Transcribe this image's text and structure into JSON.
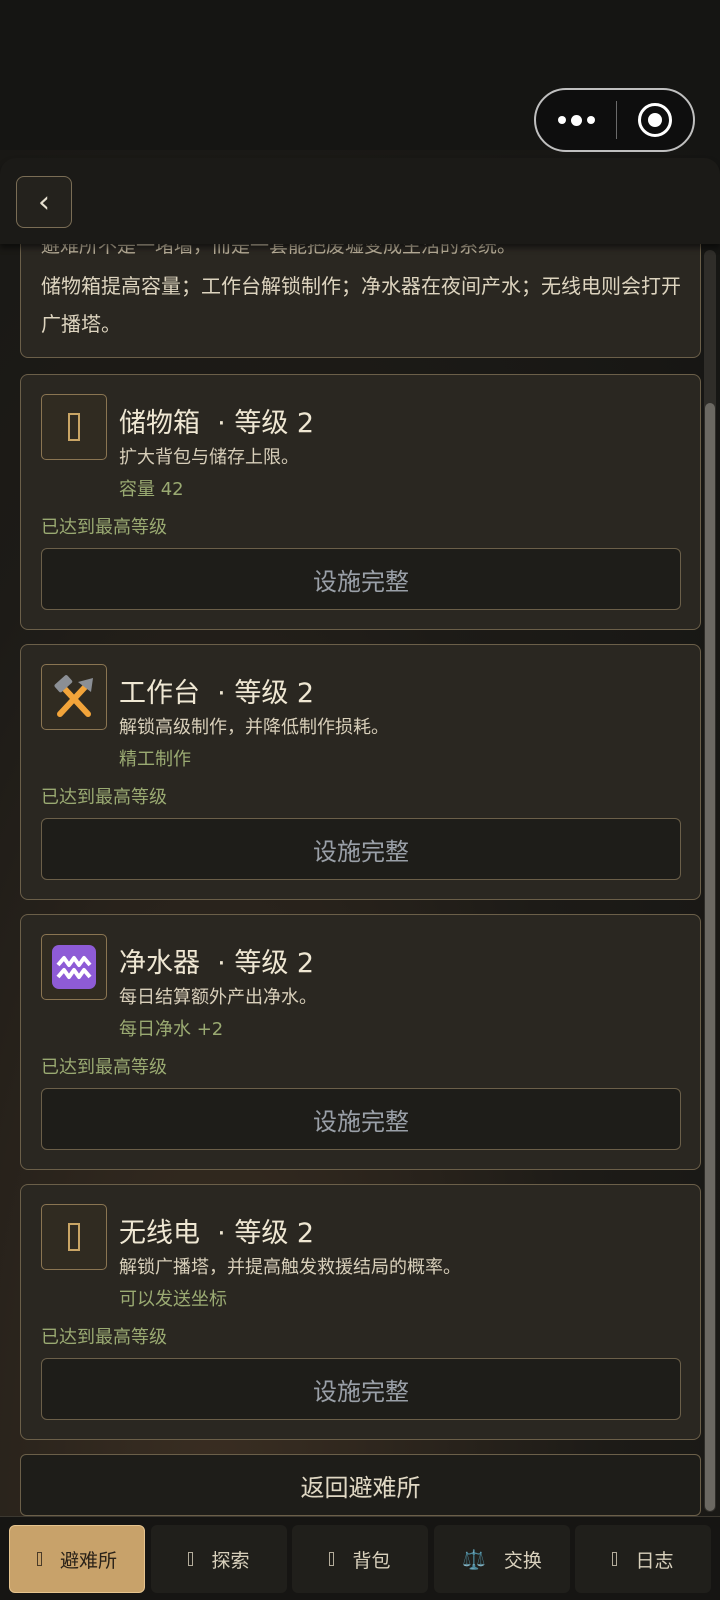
{
  "capsule": {
    "menu_icon": "more-dots-icon",
    "close_icon": "target-icon"
  },
  "header": {
    "back_icon": "chevron-left-icon",
    "back_glyph": "‹"
  },
  "intro": {
    "clipped_line": "避难所不是一堵墙，而是一套能把废墟变成生活的系统。",
    "text": "储物箱提高容量；工作台解锁制作；净水器在夜间产水；无线电则会打开广播塔。"
  },
  "facilities": [
    {
      "name": "储物箱",
      "level_label": "· 等级 2",
      "desc": "扩大背包与储存上限。",
      "effect": "容量 42",
      "status": "已达到最高等级",
      "action": "设施完整",
      "icon": "box-icon"
    },
    {
      "name": "工作台",
      "level_label": "· 等级 2",
      "desc": "解锁高级制作，并降低制作损耗。",
      "effect": "精工制作",
      "status": "已达到最高等级",
      "action": "设施完整",
      "icon": "hammer-pick-icon"
    },
    {
      "name": "净水器",
      "level_label": "· 等级 2",
      "desc": "每日结算额外产出净水。",
      "effect": "每日净水 +2",
      "status": "已达到最高等级",
      "action": "设施完整",
      "icon": "aquarius-icon"
    },
    {
      "name": "无线电",
      "level_label": "· 等级 2",
      "desc": "解锁广播塔，并提高触发救援结局的概率。",
      "effect": "可以发送坐标",
      "status": "已达到最高等级",
      "action": "设施完整",
      "icon": "box-icon"
    }
  ],
  "return_label": "返回避难所",
  "nav": [
    {
      "label": "避难所",
      "icon": "box-icon",
      "active": true
    },
    {
      "label": "探索",
      "icon": "box-icon",
      "active": false
    },
    {
      "label": "背包",
      "icon": "box-icon",
      "active": false
    },
    {
      "label": "交换",
      "icon": "scale-icon",
      "glyph": "⚖️",
      "active": false
    },
    {
      "label": "日志",
      "icon": "box-icon",
      "active": false
    }
  ],
  "colors": {
    "accent": "#c8a26a",
    "effect_green": "#9aaa72",
    "card_bg": "#2a2721",
    "border": "#6b5f49"
  }
}
